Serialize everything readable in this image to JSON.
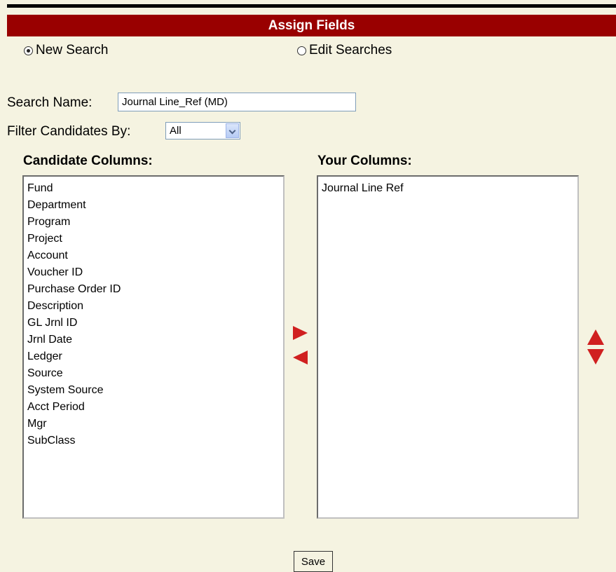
{
  "title": "Assign Fields",
  "mode": {
    "new_search": {
      "label": "New Search",
      "checked": true
    },
    "edit_searches": {
      "label": "Edit Searches",
      "checked": false
    }
  },
  "search_name": {
    "label": "Search Name:",
    "value": "Journal Line_Ref (MD)"
  },
  "filter": {
    "label": "Filter Candidates By:",
    "selected": "All"
  },
  "candidate_columns": {
    "header": "Candidate Columns:",
    "items": [
      "Fund",
      "Department",
      "Program",
      "Project",
      "Account",
      "Voucher ID",
      "Purchase Order ID",
      "Description",
      "GL Jrnl ID",
      "Jrnl Date",
      "Ledger",
      "Source",
      "System Source",
      "Acct Period",
      "Mgr",
      "SubClass"
    ]
  },
  "your_columns": {
    "header": "Your Columns:",
    "items": [
      "Journal Line Ref"
    ]
  },
  "save_label": "Save",
  "colors": {
    "accent": "#990000",
    "arrow": "#d02020",
    "background": "#f5f3e1"
  }
}
